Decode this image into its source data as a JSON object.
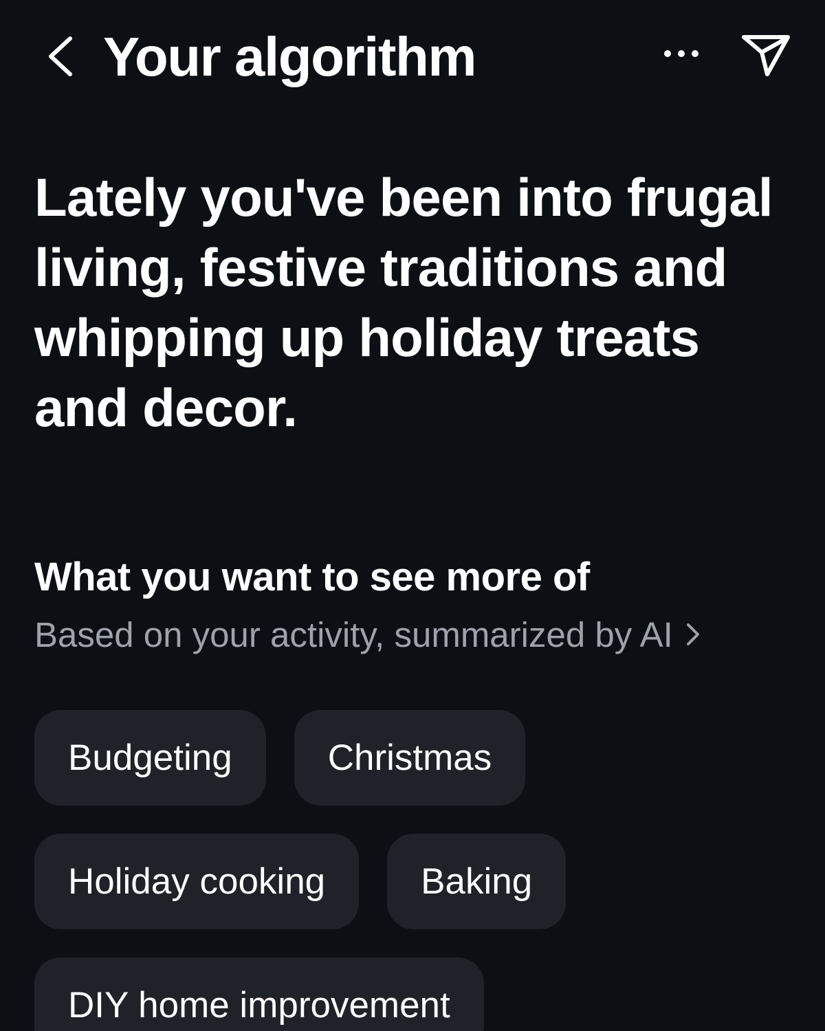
{
  "header": {
    "title": "Your algorithm",
    "back_icon": "chevron-left-icon",
    "more_icon": "more-horizontal-icon",
    "send_icon": "send-icon"
  },
  "summary": {
    "text": "Lately you've been into frugal living, festive traditions and whipping up holiday treats and decor."
  },
  "section": {
    "title": "What you want to see more of",
    "subtitle": "Based on your activity, summarized by AI",
    "subtitle_icon": "chevron-right-icon"
  },
  "topics": [
    {
      "label": "Budgeting"
    },
    {
      "label": "Christmas"
    },
    {
      "label": "Holiday cooking"
    },
    {
      "label": "Baking"
    },
    {
      "label": "DIY home improvement"
    }
  ],
  "colors": {
    "background": "#0c0f14",
    "text": "#ffffff",
    "muted_text": "#9ea2aa",
    "chip_background": "#1f2228"
  }
}
